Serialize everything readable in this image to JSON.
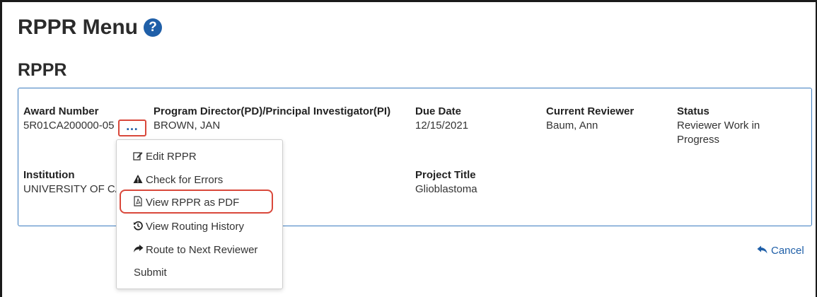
{
  "page": {
    "title": "RPPR Menu",
    "help_icon": "question-circle-icon"
  },
  "section": {
    "title": "RPPR"
  },
  "award": {
    "award_number_label": "Award Number",
    "award_number": "5R01CA200000-05",
    "pd_pi_label": "Program Director(PD)/Principal Investigator(PI)",
    "pd_pi": "BROWN, JAN",
    "due_date_label": "Due Date",
    "due_date": "12/15/2021",
    "reviewer_label": "Current Reviewer",
    "reviewer": "Baum, Ann",
    "status_label": "Status",
    "status": "Reviewer Work in Progress",
    "institution_label": "Institution",
    "institution": "UNIVERSITY OF CA",
    "project_title_label": "Project Title",
    "project_title": "Glioblastoma"
  },
  "actions": {
    "more_label": "…",
    "menu": [
      {
        "label": "Edit RPPR",
        "icon": "edit-icon"
      },
      {
        "label": "Check for Errors",
        "icon": "warning-icon"
      },
      {
        "label": "View RPPR as PDF",
        "icon": "pdf-icon"
      },
      {
        "label": "View Routing History",
        "icon": "history-icon"
      },
      {
        "label": "Route to Next Reviewer",
        "icon": "share-icon"
      },
      {
        "label": "Submit",
        "icon": ""
      }
    ]
  },
  "footer": {
    "cancel_label": "Cancel",
    "cancel_icon": "reply-icon"
  },
  "colors": {
    "accent": "#1f5fa8",
    "card_border": "#3c7cc0",
    "highlight": "#d9483b"
  }
}
